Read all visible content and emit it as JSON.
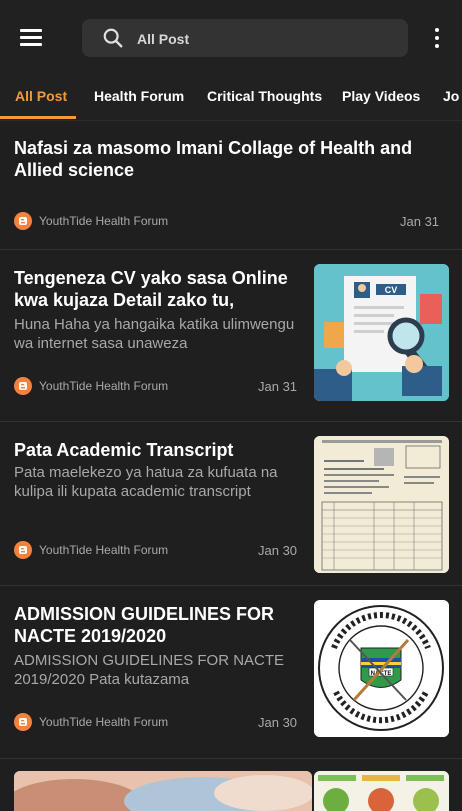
{
  "header": {
    "search_placeholder": "All Post",
    "menu_icon": "hamburger-menu-icon",
    "search_icon": "search-icon",
    "more_icon": "more-vert-icon"
  },
  "tabs": [
    {
      "label": "All Post",
      "active": true
    },
    {
      "label": "Health Forum"
    },
    {
      "label": "Critical Thoughts"
    },
    {
      "label": "Play Videos"
    },
    {
      "label": "Jo"
    }
  ],
  "posts": [
    {
      "title": "Nafasi za masomo Imani Collage of Health and Allied science",
      "snippet": "",
      "author": "YouthTide Health Forum",
      "date": "Jan 31"
    },
    {
      "title": "Tengeneza CV yako sasa Online kwa kujaza Detail zako tu,",
      "snippet": "Huna Haha ya hangaika katika ulimwengu wa internet sasa unaweza",
      "author": "YouthTide Health Forum",
      "date": "Jan 31",
      "thumb_label": "CV"
    },
    {
      "title": "Pata Academic Transcript",
      "snippet": "Pata maelekezo ya hatua za kufuata na kulipa ili kupata academic transcript",
      "author": "YouthTide Health Forum",
      "date": "Jan 30"
    },
    {
      "title": "ADMISSION GUIDELINES FOR NACTE 2019/2020",
      "snippet": "ADMISSION GUIDELINES FOR NACTE 2019/2020 Pata kutazama",
      "author": "YouthTide Health Forum",
      "date": "Jan 30",
      "thumb_label": "NACTE"
    }
  ],
  "colors": {
    "accent": "#f39a38",
    "background": "#1f1f1f",
    "blogger": "#f5813f"
  }
}
